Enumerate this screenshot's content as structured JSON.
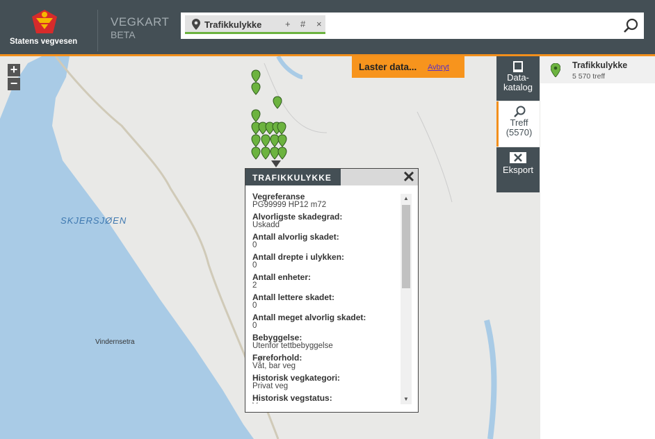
{
  "header": {
    "org_name": "Statens vegvesen",
    "app_title": "VEGKART",
    "app_subtitle": "BETA",
    "search_chip": {
      "label": "Trafikkulykke",
      "add_label": "+",
      "hash_label": "#",
      "remove_label": "×"
    }
  },
  "map": {
    "zoom_in_label": "+",
    "zoom_out_label": "−",
    "loading_text": "Laster data...",
    "cancel_label": "Avbryt",
    "lake_label": "SKJERSJØEN",
    "place_label": "Vindernsetra"
  },
  "popup": {
    "title": "TRAFIKKULYKKE",
    "attributes": [
      {
        "name": "Vegreferanse",
        "value": "PG99999 HP12 m72"
      },
      {
        "name": "Alvorligste skadegrad:",
        "value": "Uskadd"
      },
      {
        "name": "Antall alvorlig skadet:",
        "value": "0"
      },
      {
        "name": "Antall drepte i ulykken:",
        "value": "0"
      },
      {
        "name": "Antall enheter:",
        "value": "2"
      },
      {
        "name": "Antall lettere skadet:",
        "value": "0"
      },
      {
        "name": "Antall meget alvorlig skadet:",
        "value": "0"
      },
      {
        "name": "Bebyggelse:",
        "value": "Utenfor tettbebyggelse"
      },
      {
        "name": "Føreforhold:",
        "value": "Våt, bar veg"
      },
      {
        "name": "Historisk vegkategori:",
        "value": "Privat veg"
      },
      {
        "name": "Historisk vegstatus:",
        "value": "Vegg..."
      }
    ]
  },
  "sidetabs": {
    "datakatalog": "Data-\nkatalog",
    "treff_label": "Treff",
    "treff_count": "(5570)",
    "eksport": "Eksport"
  },
  "results": {
    "name": "Trafikkulykke",
    "count": "5 570 treff"
  },
  "colors": {
    "header_bg": "#444f55",
    "accent": "#f28f1c",
    "marker_green": "#6cb33f",
    "water": "#a9cbe6"
  }
}
